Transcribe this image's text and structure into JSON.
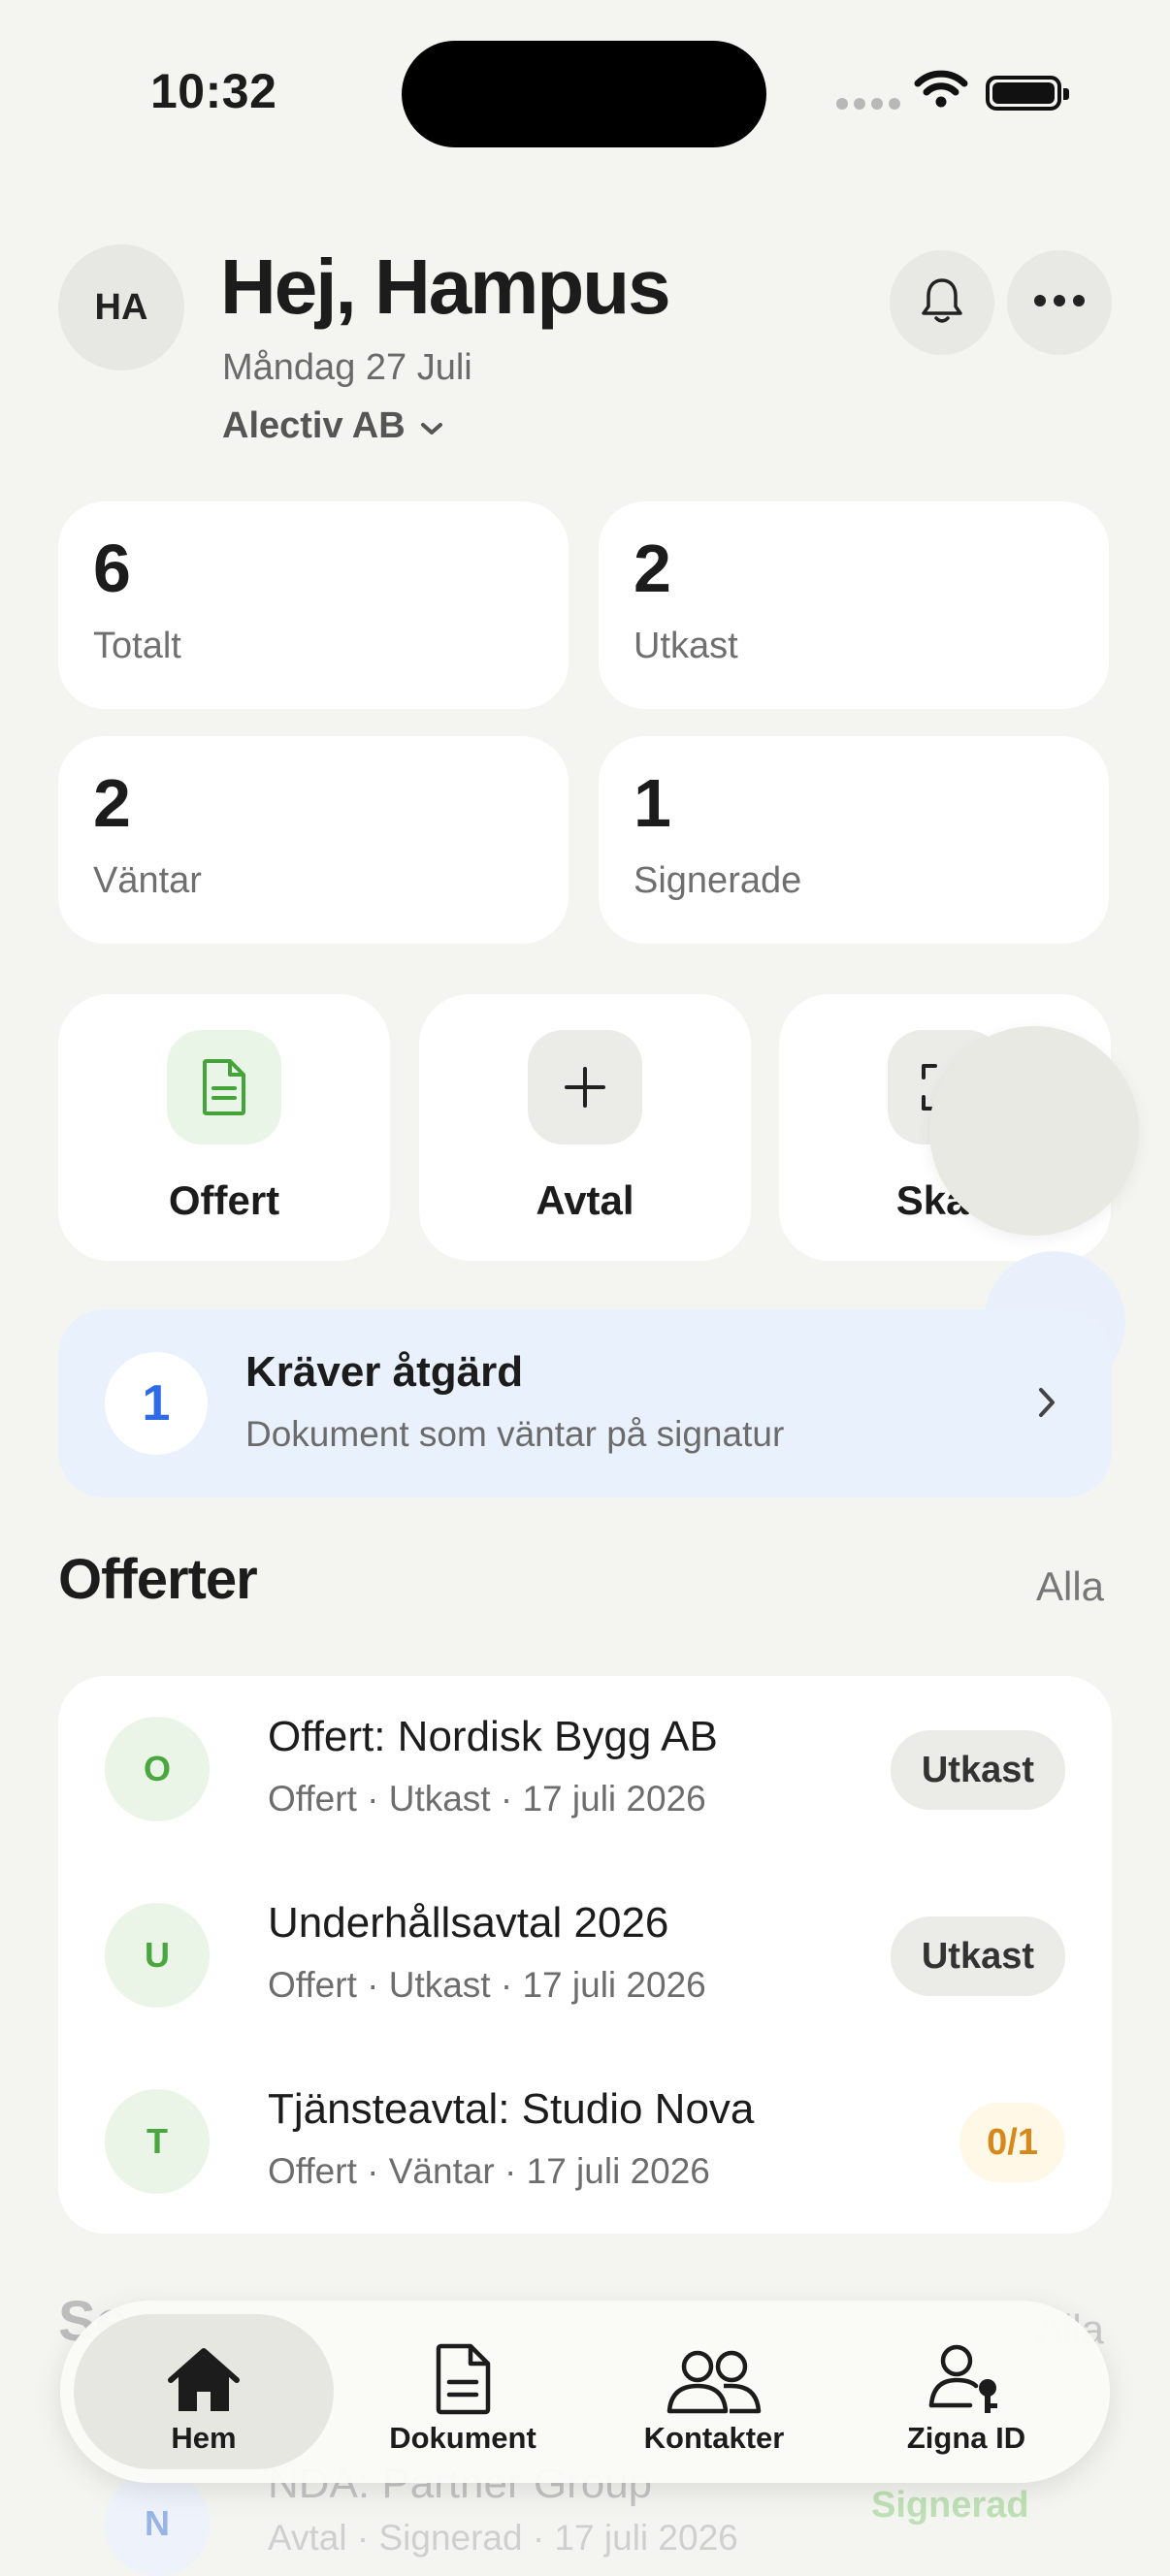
{
  "status_bar": {
    "time": "10:32"
  },
  "header": {
    "avatar_initials": "HA",
    "greeting": "Hej, Hampus",
    "date": "Måndag 27 Juli",
    "company": "Alectiv AB"
  },
  "stats": [
    {
      "value": "6",
      "label": "Totalt"
    },
    {
      "value": "2",
      "label": "Utkast"
    },
    {
      "value": "2",
      "label": "Väntar"
    },
    {
      "value": "1",
      "label": "Signerade"
    }
  ],
  "actions": [
    {
      "label": "Offert",
      "icon": "document-icon"
    },
    {
      "label": "Avtal",
      "icon": "plus-icon"
    },
    {
      "label": "Skan",
      "icon": "scan-icon"
    }
  ],
  "action_required": {
    "count": "1",
    "title": "Kräver åtgärd",
    "subtitle": "Dokument som väntar på signatur"
  },
  "offers_section": {
    "title": "Offerter",
    "all_label": "Alla",
    "items": [
      {
        "letter": "O",
        "title": "Offert: Nordisk Bygg AB",
        "meta": "Offert · Utkast · 17 juli 2026",
        "status": "Utkast"
      },
      {
        "letter": "U",
        "title": "Underhållsavtal 2026",
        "meta": "Offert · Utkast · 17 juli 2026",
        "status": "Utkast"
      },
      {
        "letter": "T",
        "title": "Tjänsteavtal: Studio Nova",
        "meta": "Offert · Väntar · 17 juli 2026",
        "status": "0/1"
      }
    ]
  },
  "behind_section": {
    "title": "Se",
    "all_label": "Alla",
    "row_letter": "N",
    "row_title": "NDA: Partner Group",
    "row_meta": "Avtal · Signerad · 17 juli 2026",
    "row_status": "Signerad"
  },
  "tabbar": {
    "items": [
      {
        "label": "Hem",
        "icon": "home-icon"
      },
      {
        "label": "Dokument",
        "icon": "document-icon"
      },
      {
        "label": "Kontakter",
        "icon": "contacts-icon"
      },
      {
        "label": "Zigna ID",
        "icon": "id-key-icon"
      }
    ]
  },
  "colors": {
    "background": "#f4f4f0",
    "accent_green": "#4aa63e",
    "accent_blue": "#2f6be6",
    "waiting_orange": "#d6891b"
  }
}
